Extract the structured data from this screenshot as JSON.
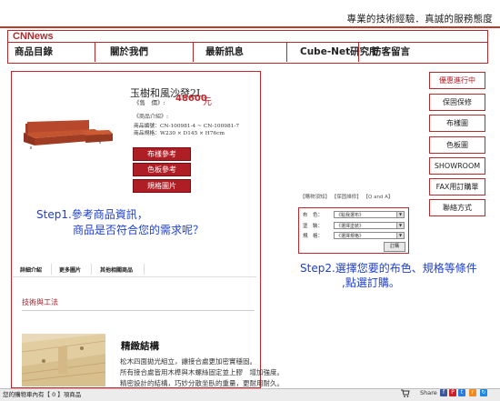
{
  "header": {
    "slogan": "專業的技術經驗．真誠的服務態度",
    "brand": "CNNews",
    "nav": [
      "商品目錄",
      "關於我們",
      "最新訊息",
      "Cube-Net研究所",
      "訪客留言"
    ]
  },
  "product": {
    "name": "玉樹和風沙發2L",
    "price_label": "《售　價》:",
    "price": "48600",
    "price_unit": "元",
    "intro_label": "《商品介紹》:",
    "model": "商品編號：CN-100981-4 ~ CN-100981-7",
    "size": "商品規格：W230 × D145 × H76cm",
    "buttons": [
      "布樣參考",
      "色板參考",
      "規格圖片"
    ]
  },
  "right_links": [
    "優惠進行中",
    "保固保修",
    "布樣圖",
    "色板圖",
    "SHOWROOM",
    "FAX用訂購單",
    "聯絡方式"
  ],
  "mini_links": "【購物須知】 【保固維修】 【Q and A】",
  "options": {
    "rows": [
      {
        "label": "布　色：",
        "value": "《點我選布》"
      },
      {
        "label": "塗　裝：",
        "value": "《選擇塗裝》"
      },
      {
        "label": "規　格：",
        "value": "《選擇規格》"
      }
    ],
    "order_button": "訂購"
  },
  "annotations": {
    "step1_line1": "Step1.參考商品資訊，",
    "step1_line2": "商品是否符合您的需求呢？",
    "step2_line1": "Step2.選擇您要的布色、規格等條件",
    "step2_line2": ",點選訂購。"
  },
  "tabs": [
    "詳細介紹",
    "更多圖片",
    "其他相關商品"
  ],
  "section": {
    "title": "技術與工法",
    "feature_title": "精緻結構",
    "feature_lines": [
      "松木四面拋光組立，讓接合處更加密實穩固。",
      "所有接合處皆用木榫與木螺絲固定並上膠　增加強度。",
      "精密設計的結構，巧妙分散坐臥的重量，更耐用耐久。"
    ]
  },
  "status": {
    "text": "您的購物車內有【 0 】項商品",
    "share": "Share"
  },
  "colors": {
    "brand_red": "#b52a2a",
    "button_red": "#b01e25",
    "annotation_blue": "#1d3fd6"
  }
}
